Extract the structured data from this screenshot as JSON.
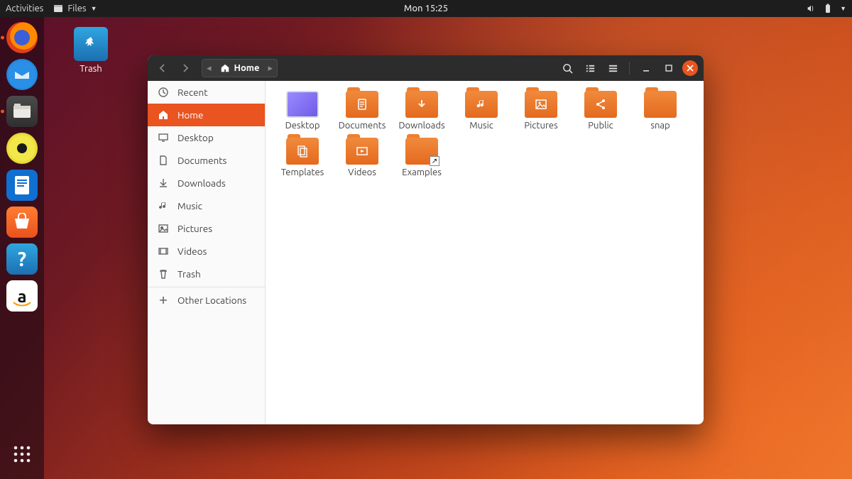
{
  "topbar": {
    "activities": "Activities",
    "app_label": "Files",
    "clock": "Mon 15:25"
  },
  "desktop": {
    "trash_label": "Trash"
  },
  "dock": {
    "items": [
      {
        "name": "firefox",
        "running": true
      },
      {
        "name": "thunderbird",
        "running": false
      },
      {
        "name": "files",
        "running": true,
        "active": true
      },
      {
        "name": "rhythmbox",
        "running": false
      },
      {
        "name": "libreoffice-writer",
        "running": false
      },
      {
        "name": "software",
        "running": false
      },
      {
        "name": "help",
        "running": false
      },
      {
        "name": "amazon",
        "running": false
      }
    ]
  },
  "window": {
    "path_current": "Home",
    "sidebar": [
      {
        "icon": "recent",
        "label": "Recent"
      },
      {
        "icon": "home",
        "label": "Home",
        "active": true
      },
      {
        "icon": "desktop",
        "label": "Desktop"
      },
      {
        "icon": "documents",
        "label": "Documents"
      },
      {
        "icon": "downloads",
        "label": "Downloads"
      },
      {
        "icon": "music",
        "label": "Music"
      },
      {
        "icon": "pictures",
        "label": "Pictures"
      },
      {
        "icon": "videos",
        "label": "Videos"
      },
      {
        "icon": "trash",
        "label": "Trash"
      }
    ],
    "other_locations": "Other Locations",
    "folders": [
      {
        "label": "Desktop",
        "kind": "desktop"
      },
      {
        "label": "Documents",
        "kind": "folder",
        "glyph": "doc"
      },
      {
        "label": "Downloads",
        "kind": "folder",
        "glyph": "down"
      },
      {
        "label": "Music",
        "kind": "folder",
        "glyph": "music"
      },
      {
        "label": "Pictures",
        "kind": "folder",
        "glyph": "pic"
      },
      {
        "label": "Public",
        "kind": "folder",
        "glyph": "share"
      },
      {
        "label": "snap",
        "kind": "folder",
        "glyph": ""
      },
      {
        "label": "Templates",
        "kind": "folder",
        "glyph": "tpl"
      },
      {
        "label": "Videos",
        "kind": "folder",
        "glyph": "vid"
      },
      {
        "label": "Examples",
        "kind": "folder",
        "glyph": "",
        "shortcut": true
      }
    ]
  }
}
